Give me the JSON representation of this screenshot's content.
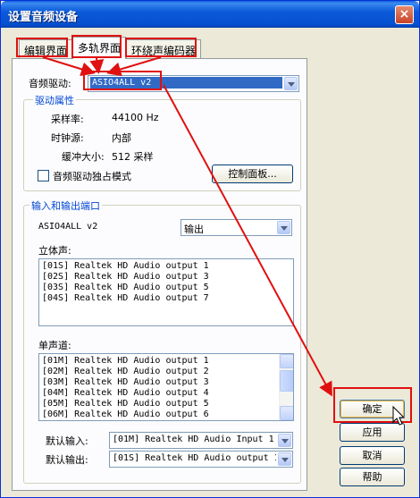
{
  "window": {
    "title": "设置音频设备",
    "close_glyph": "×"
  },
  "tabs": [
    {
      "label": "编辑界面"
    },
    {
      "label": "多轨界面"
    },
    {
      "label": "环绕声编码器"
    }
  ],
  "driver": {
    "label": "音频驱动:",
    "value": "ASIO4ALL v2"
  },
  "driver_props": {
    "title": "驱动属性",
    "sample_rate_label": "采样率:",
    "sample_rate_value": "44100 Hz",
    "clock_label": "时钟源:",
    "clock_value": "内部",
    "buffer_label": "缓冲大小:",
    "buffer_value": "512 采样",
    "exclusive_label": "音频驱动独占模式",
    "control_panel_label": "控制面板..."
  },
  "ports": {
    "title": "输入和输出端口",
    "device_name": "ASIO4ALL v2",
    "direction_value": "输出",
    "stereo_label": "立体声:",
    "stereo_items": [
      "[01S] Realtek HD Audio output 1",
      "[02S] Realtek HD Audio output 3",
      "[03S] Realtek HD Audio output 5",
      "[04S] Realtek HD Audio output 7"
    ],
    "mono_label": "单声道:",
    "mono_items": [
      "[01M] Realtek HD Audio output 1",
      "[02M] Realtek HD Audio output 2",
      "[03M] Realtek HD Audio output 3",
      "[04M] Realtek HD Audio output 4",
      "[05M] Realtek HD Audio output 5",
      "[06M] Realtek HD Audio output 6"
    ],
    "default_input_label": "默认输入:",
    "default_input_value": "[01M] Realtek HD Audio Input 1",
    "default_output_label": "默认输出:",
    "default_output_value": "[01S] Realtek HD Audio output 1"
  },
  "buttons": {
    "ok": "确定",
    "apply": "应用",
    "cancel": "取消",
    "help": "帮助"
  },
  "colors": {
    "annotation_red": "#e01010",
    "selection_blue": "#316ac5",
    "group_title_blue": "#0046d5"
  }
}
